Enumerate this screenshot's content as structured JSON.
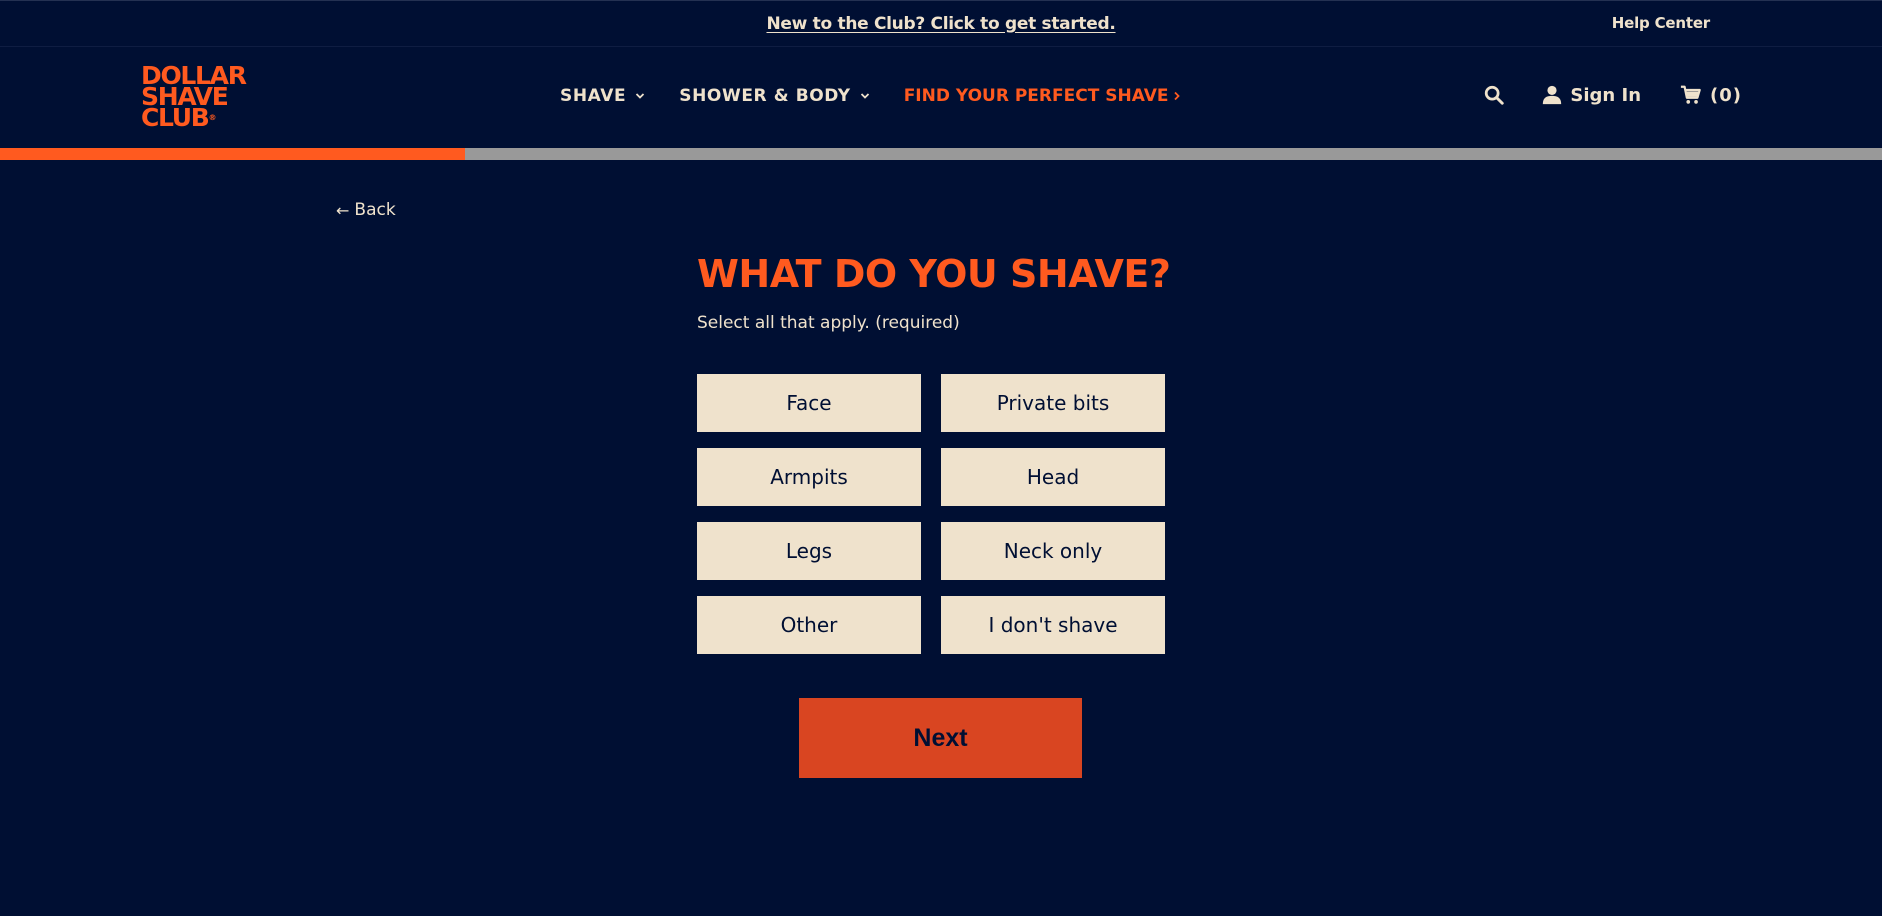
{
  "banner": {
    "promo_link": "New to the Club? Click to get started.",
    "help_center": "Help Center"
  },
  "logo": {
    "line1": "DOLLAR",
    "line2": "SHAVE",
    "line3": "CLUB",
    "mark": "®"
  },
  "nav": {
    "shave": "SHAVE",
    "shower_body": "SHOWER & BODY",
    "find_shave": "FIND YOUR PERFECT SHAVE"
  },
  "header_actions": {
    "sign_in": "Sign In",
    "cart_count": "(0)"
  },
  "progress": {
    "fraction": 0.247,
    "fill_color": "#ff5a1f",
    "track_color": "#999999"
  },
  "page": {
    "back_label": "Back",
    "question": "WHAT DO YOU SHAVE?",
    "instruction": "Select all that apply. (required)",
    "options": [
      "Face",
      "Private bits",
      "Armpits",
      "Head",
      "Legs",
      "Neck only",
      "Other",
      "I don't shave"
    ],
    "next_label": "Next"
  },
  "colors": {
    "background": "#000f33",
    "accent": "#ff5a1f",
    "option_bg": "#efe2cc",
    "next_bg": "#d94521"
  },
  "icons": {
    "search": "search-icon",
    "user": "user-icon",
    "cart": "cart-icon",
    "chevron": "chevron-down-icon",
    "back_arrow": "arrow-left-icon"
  }
}
